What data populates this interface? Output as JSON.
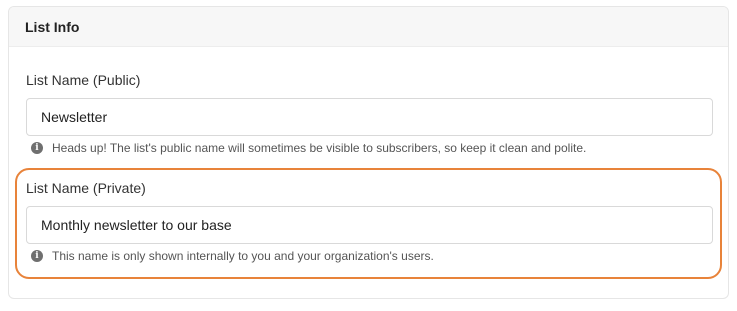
{
  "card": {
    "title": "List Info"
  },
  "public_name": {
    "label": "List Name (Public)",
    "value": "Newsletter",
    "help": "Heads up! The list's public name will sometimes be visible to subscribers, so keep it clean and polite.",
    "help_icon": "info-icon"
  },
  "private_name": {
    "label": "List Name (Private)",
    "value": "Monthly newsletter to our base",
    "help": "This name is only shown internally to you and your organization's users.",
    "help_icon": "info-icon"
  },
  "highlight_color": "#e8833a"
}
